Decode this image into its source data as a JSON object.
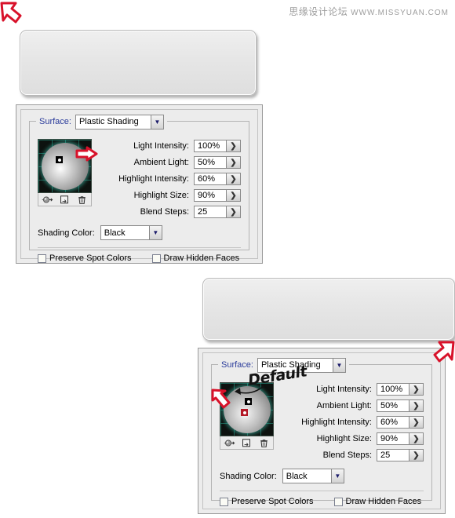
{
  "watermark": {
    "forum": "思缘设计论坛",
    "url": "WWW.MISSYUAN.COM"
  },
  "annotations": {
    "default_note": "Default"
  },
  "colors": {
    "panel_bg": "#ececec",
    "legend_text": "#2b3c9b",
    "arrow_red": "#d8122a",
    "sphere_grid": "#28a08c",
    "plate_fill": "#e6e6e6"
  },
  "icons": {
    "cursor_top_left": "arrow-cursor-down-right-icon",
    "cursor_bottom_right": "arrow-cursor-up-left-icon",
    "light_source": "new-light-source-icon",
    "duplicate": "duplicate-light-icon",
    "delete": "trash-icon",
    "combo_chevron": "chevron-down-icon",
    "spin_chevron": "chevron-right-icon"
  },
  "panels": [
    {
      "id": "panel-1",
      "legend_label": "Surface:",
      "surface": {
        "value": "Plastic Shading"
      },
      "fields": [
        {
          "label": "Light Intensity:",
          "value": "100%"
        },
        {
          "label": "Ambient Light:",
          "value": "50%"
        },
        {
          "label": "Highlight Intensity:",
          "value": "60%"
        },
        {
          "label": "Highlight Size:",
          "value": "90%"
        },
        {
          "label": "Blend Steps:",
          "value": "25"
        }
      ],
      "shading_color": {
        "label": "Shading Color:",
        "value": "Black"
      },
      "checkboxes": [
        {
          "label": "Preserve Spot Colors",
          "checked": false
        },
        {
          "label": "Draw Hidden Faces",
          "checked": false
        }
      ]
    },
    {
      "id": "panel-2",
      "legend_label": "Surface:",
      "surface": {
        "value": "Plastic Shading"
      },
      "fields": [
        {
          "label": "Light Intensity:",
          "value": "100%"
        },
        {
          "label": "Ambient Light:",
          "value": "50%"
        },
        {
          "label": "Highlight Intensity:",
          "value": "60%"
        },
        {
          "label": "Highlight Size:",
          "value": "90%"
        },
        {
          "label": "Blend Steps:",
          "value": "25"
        }
      ],
      "shading_color": {
        "label": "Shading Color:",
        "value": "Black"
      },
      "checkboxes": [
        {
          "label": "Preserve Spot Colors",
          "checked": false
        },
        {
          "label": "Draw Hidden Faces",
          "checked": false
        }
      ]
    }
  ]
}
